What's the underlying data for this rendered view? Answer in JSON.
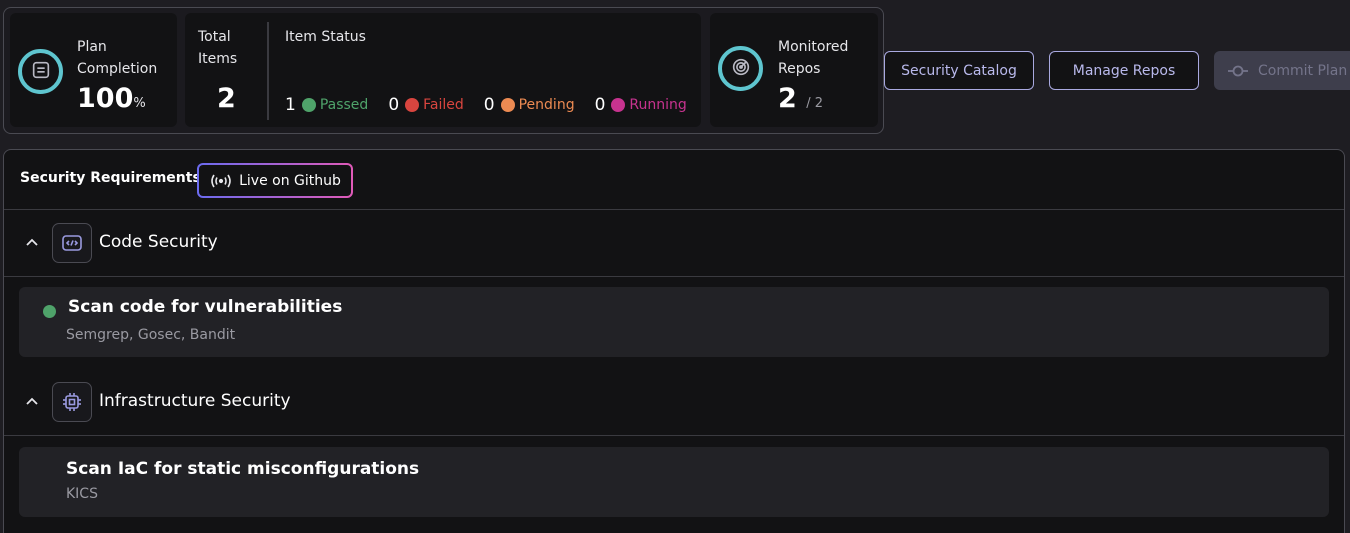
{
  "stats": {
    "plan": {
      "label": "Plan Completion",
      "value": "100",
      "unit": "%",
      "icon": "server-icon"
    },
    "total": {
      "label": "Total Items",
      "value": "2"
    },
    "status": {
      "label": "Item Status",
      "items": [
        {
          "count": "1",
          "label": "Passed",
          "color": "#4fa36a"
        },
        {
          "count": "0",
          "label": "Failed",
          "color": "#d9453f"
        },
        {
          "count": "0",
          "label": "Pending",
          "color": "#ec8a52"
        },
        {
          "count": "0",
          "label": "Running",
          "color": "#c7338f"
        }
      ]
    },
    "repos": {
      "label": "Monitored Repos",
      "value": "2",
      "suffix": "/ 2",
      "icon": "radar-icon"
    }
  },
  "actions": {
    "catalog": "Security Catalog",
    "manage_repos": "Manage Repos",
    "commit_plan": "Commit Plan"
  },
  "colors": {
    "accent_ring": "#5ec5cf",
    "button_text": "#b9b9ec"
  },
  "panel": {
    "title": "Security Requirements",
    "live_label": "Live on Github",
    "sections": [
      {
        "label": "Code Security",
        "icon": "code-icon",
        "items": [
          {
            "title": "Scan code for vulnerabilities",
            "tools": "Semgrep, Gosec, Bandit",
            "status": "passed"
          }
        ]
      },
      {
        "label": "Infrastructure Security",
        "icon": "chip-icon",
        "items": [
          {
            "title": "Scan IaC for static misconfigurations",
            "tools": "KICS",
            "status": "none"
          }
        ]
      }
    ]
  }
}
